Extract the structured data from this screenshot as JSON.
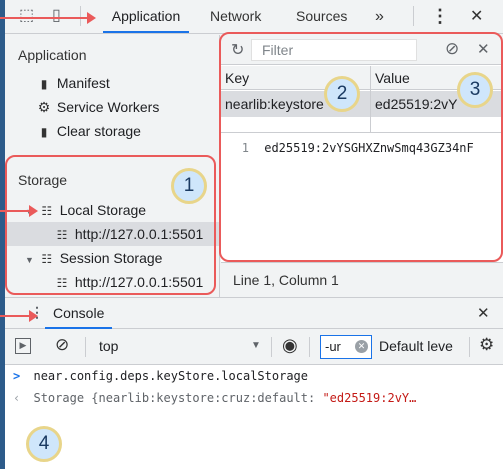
{
  "tabbar": {
    "tabs": [
      "Application",
      "Network",
      "Sources"
    ],
    "more": "»",
    "menu": "⋮",
    "close": "✕"
  },
  "sidebar": {
    "application_title": "Application",
    "application_items": [
      "Manifest",
      "Service Workers",
      "Clear storage"
    ],
    "storage_title": "Storage",
    "local_storage": "Local Storage",
    "local_origin": "http://127.0.0.1:5501",
    "session_storage": "Session Storage",
    "session_origin": "http://127.0.0.1:5501"
  },
  "storage_view": {
    "filter_placeholder": "Filter",
    "col_key": "Key",
    "col_value": "Value",
    "row_key": "nearlib:keystore",
    "row_value": "ed25519:2vY",
    "line_no": "1",
    "line_text": "ed25519:2vYSGHXZnwSmq43GZ34nF",
    "status": "Line 1, Column 1"
  },
  "drawer": {
    "title": "Console",
    "close": "✕"
  },
  "console_toolbar": {
    "context": "top",
    "filter_value": "-ur",
    "levels": "Default leve"
  },
  "console": {
    "input_line": "near.config.deps.keyStore.localStorage",
    "output_line": "Storage {nearlib:keystore:cruz:default: ",
    "output_value": "\"ed25519:2vY…"
  },
  "annotations": [
    "1",
    "2",
    "3",
    "4"
  ],
  "colors": {
    "accent": "#1a73e8",
    "callout": "#ea5a5a",
    "badge_fill": "#cfe6fb",
    "badge_ring": "#e8d58a",
    "string": "#c41a16",
    "background": "#2d5b8a"
  }
}
